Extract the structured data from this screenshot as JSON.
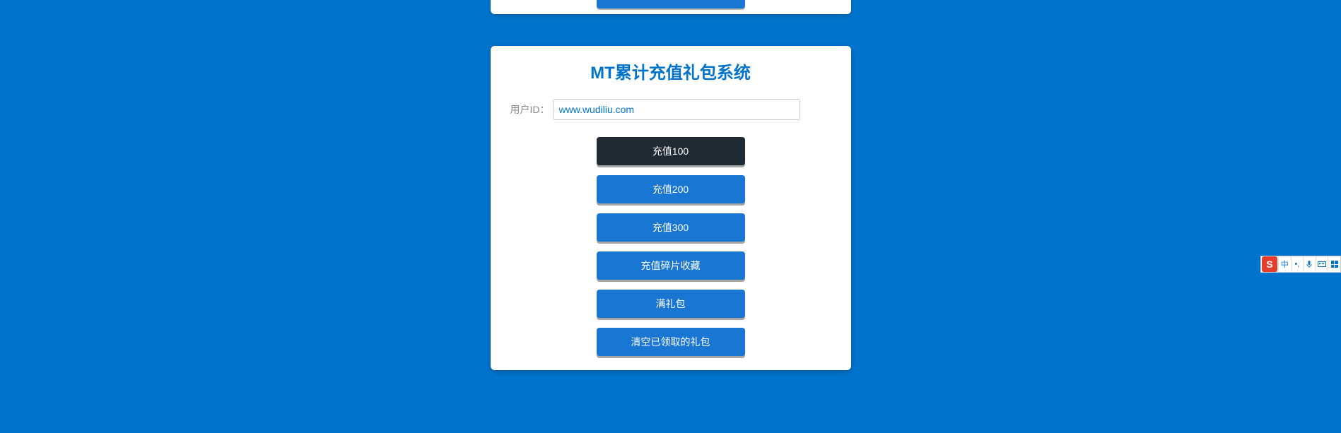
{
  "card": {
    "title": "MT累计充值礼包系统",
    "userIdLabel": "用户ID：",
    "userIdValue": "www.wudiliu.com",
    "buttons": {
      "recharge100": "充值100",
      "recharge200": "充值200",
      "recharge300": "充值300",
      "fragmentCollect": "充值碎片收藏",
      "fullGift": "满礼包",
      "clearClaimed": "清空已领取的礼包"
    }
  },
  "ime": {
    "logo": "S",
    "lang": "中",
    "punct": "•,",
    "mic": "🎤"
  }
}
